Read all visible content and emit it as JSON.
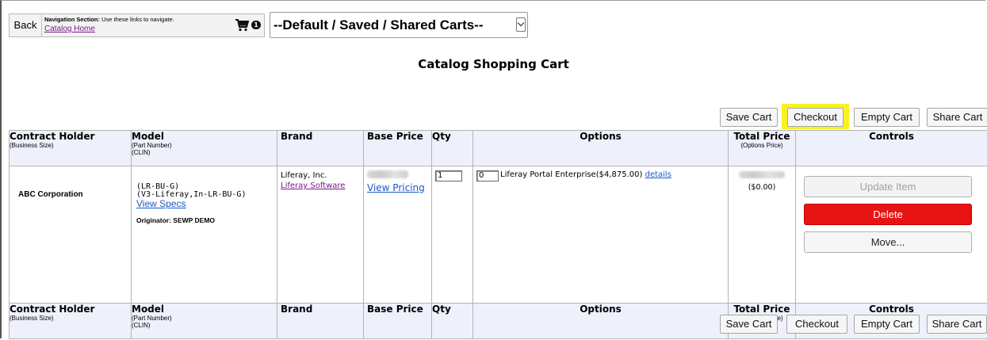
{
  "nav": {
    "back_label": "Back",
    "section_title": "Navigation Section:",
    "section_hint": "Use these links to navigate.",
    "catalog_home_link": "Catalog Home",
    "cart_icon": "shopping-cart-icon",
    "cart_count": "1"
  },
  "carts_select": {
    "selected": "--Default / Saved / Shared Carts--"
  },
  "page_title": "Catalog Shopping Cart",
  "toolbar": {
    "save_label": "Save Cart",
    "checkout_label": "Checkout",
    "empty_label": "Empty Cart",
    "share_label": "Share Cart",
    "highlight_color": "#f7f31f"
  },
  "table": {
    "headers": {
      "holder": "Contract Holder",
      "holder_sub": "(Business Size)",
      "model": "Model",
      "model_sub1": "(Part Number)",
      "model_sub2": "(CLIN)",
      "brand": "Brand",
      "base_price": "Base Price",
      "qty": "Qty",
      "options": "Options",
      "total_price": "Total Price",
      "total_price_sub": "(Options Price)",
      "controls": "Controls"
    },
    "row": {
      "holder": "ABC Corporation",
      "part_number": "(LR-BU-G)",
      "clin": "(V3-Liferay,In-LR-BU-G)",
      "view_specs": "View Specs",
      "originator": "Originator: SEWP DEMO",
      "brand_name": "Liferay, Inc.",
      "brand_link": "Liferay Software",
      "view_pricing": "View Pricing",
      "qty": "1",
      "option_qty": "0",
      "option_text": "Liferay Portal Enterprise($4,875.00)",
      "option_details": "details",
      "options_price": "($0.00)",
      "update_label": "Update Item",
      "delete_label": "Delete",
      "move_label": "Move...",
      "delete_color": "#e81313"
    }
  }
}
